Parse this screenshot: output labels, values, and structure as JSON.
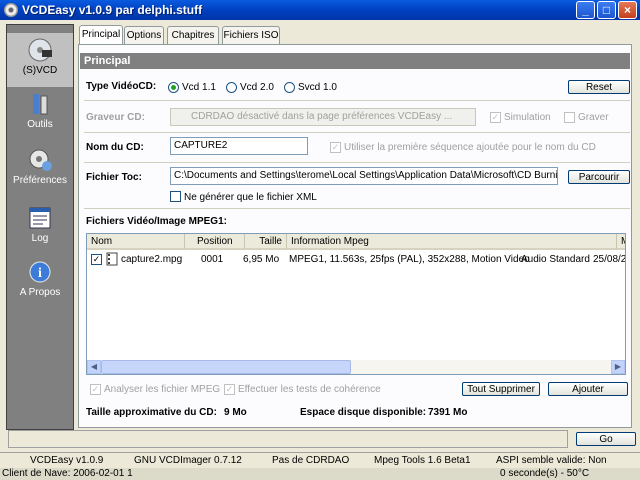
{
  "window": {
    "title": "VCDEasy v1.0.9 par delphi.stuff",
    "min": "_",
    "max": "□",
    "close": "×"
  },
  "sidebar": [
    {
      "label": "(S)VCD",
      "icon": "disc-icon"
    },
    {
      "label": "Outils",
      "icon": "tools-icon"
    },
    {
      "label": "Préférences",
      "icon": "preferences-icon"
    },
    {
      "label": "Log",
      "icon": "log-icon"
    },
    {
      "label": "A Propos",
      "icon": "info-icon"
    }
  ],
  "tabs": [
    "Principal",
    "Options",
    "Chapitres",
    "Fichiers ISO"
  ],
  "section_title": "Principal",
  "type_video": {
    "label": "Type VidéoCD:",
    "options": [
      "Vcd 1.1",
      "Vcd 2.0",
      "Svcd 1.0"
    ],
    "selected": 0,
    "reset_label": "Reset"
  },
  "graveur": {
    "label": "Graveur CD:",
    "value": "CDRDAO désactivé dans la page préférences VCDEasy ...",
    "simulation_label": "Simulation",
    "graver_label": "Graver"
  },
  "nom_cd": {
    "label": "Nom du CD:",
    "value": "CAPTURE2",
    "hint": "Utiliser la première séquence ajoutée pour le nom du CD"
  },
  "fichier_toc": {
    "label": "Fichier Toc:",
    "value": "C:\\Documents and Settings\\terome\\Local Settings\\Application Data\\Microsoft\\CD Burning\\vcd",
    "browse_label": "Parcourir",
    "xml_label": "Ne générer que le fichier XML"
  },
  "files": {
    "label": "Fichiers Vidéo/Image MPEG1:",
    "columns": [
      "Nom",
      "Position",
      "Taille",
      "Information Mpeg",
      "M"
    ],
    "rows": [
      {
        "name": "capture2.mpg",
        "position": "0001",
        "size": "6,95 Mo",
        "info": "MPEG1, 11.563s, 25fps (PAL), 352x288, Motion Video",
        "audio": "Audio Standard",
        "date": "25/08/2"
      }
    ]
  },
  "analyze_label": "Analyser les fichier MPEG",
  "coherence_label": "Effectuer les tests de cohérence",
  "remove_all_label": "Tout Supprimer",
  "add_label": "Ajouter",
  "taille": {
    "label": "Taille approximative du CD:",
    "value": "9 Mo"
  },
  "espace": {
    "label": "Espace disque disponible:",
    "value": "7391 Mo"
  },
  "go_label": "Go",
  "status": [
    "VCDEasy v1.0.9",
    "GNU VCDImager 0.7.12",
    "Pas de CDRDAO",
    "Mpeg Tools 1.6 Beta1",
    "ASPI semble valide: Non",
    "0 seconde(s) - 50°C"
  ],
  "taskbar_text": "Client de Nave: 2006-02-01  1"
}
